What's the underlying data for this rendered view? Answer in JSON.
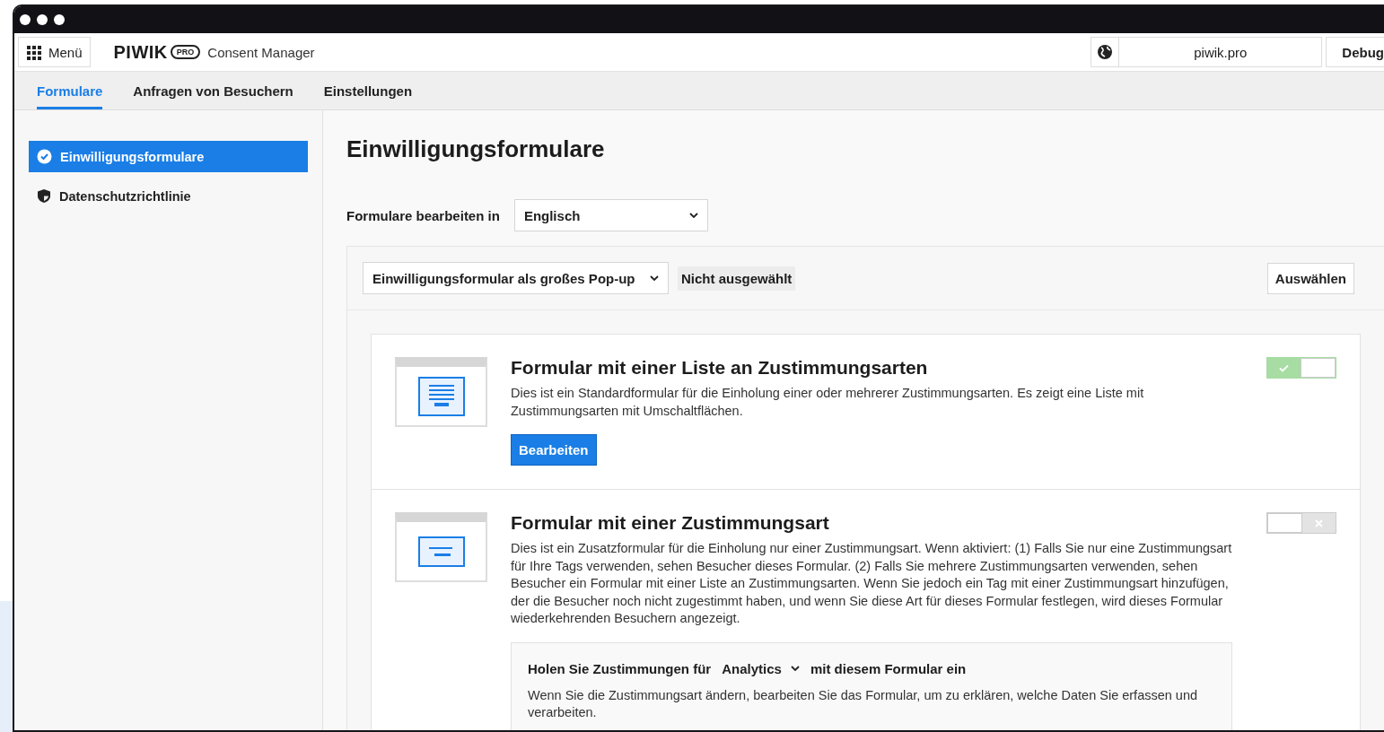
{
  "header": {
    "menu_button": "Menü",
    "logo": "PIWIK",
    "logo_badge": "PRO",
    "product": "Consent Manager",
    "site": "piwik.pro",
    "debug_button": "Debug"
  },
  "tabs": [
    {
      "label": "Formulare",
      "selected": true
    },
    {
      "label": "Anfragen von Besuchern",
      "selected": false
    },
    {
      "label": "Einstellungen",
      "selected": false
    }
  ],
  "sidebar": {
    "items": [
      {
        "label": "Einwilligungsformulare",
        "selected": true
      },
      {
        "label": "Datenschutzrichtlinie",
        "selected": false
      }
    ]
  },
  "main": {
    "title": "Einwilligungsformulare",
    "language_label": "Formulare bearbeiten in",
    "language_select": "Englisch",
    "panel": {
      "form_select": "Einwilligungsformular als großes Pop-up",
      "status": "Nicht ausgewählt",
      "select_button": "Auswählen",
      "forms": [
        {
          "kind": "list",
          "title": "Formular mit einer Liste an Zustimmungsarten",
          "description": "Dies ist ein Standardformular für die Einholung einer oder mehrerer Zustimmungsarten. Es zeigt eine Liste mit Zustimmungsarten mit Umschaltflächen.",
          "enabled": true,
          "edit_button": "Bearbeiten"
        },
        {
          "kind": "single",
          "title": "Formular mit einer Zustimmungsart",
          "description": "Dies ist ein Zusatzformular für die Einholung nur einer Zustimmungsart. Wenn aktiviert: (1) Falls Sie nur eine Zustimmungsart für Ihre Tags verwenden, sehen Besucher dieses Formular. (2) Falls Sie mehrere Zustimmungsarten verwenden, sehen Besucher ein Formular mit einer Liste an Zustimmungsarten. Wenn Sie jedoch ein Tag mit einer Zustimmungsart hinzufügen, der die Besucher noch nicht zugestimmt haben, und wenn Sie diese Art für dieses Formular festlegen, wird dieses Formular wiederkehrenden Besuchern angezeigt.",
          "enabled": false,
          "consent": {
            "prefix": "Holen Sie Zustimmungen für",
            "type_select": "Analytics",
            "suffix": "mit diesem Formular ein",
            "note": "Wenn Sie die Zustimmungsart ändern, bearbeiten Sie das Formular, um zu erklären, welche Daten Sie erfassen und verarbeiten."
          }
        }
      ]
    }
  }
}
